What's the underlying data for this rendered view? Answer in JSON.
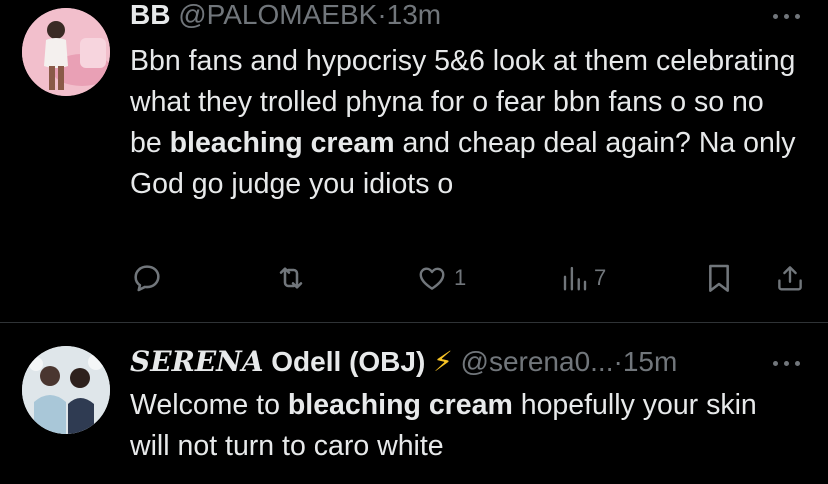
{
  "tweet1": {
    "name": "BB",
    "handle": "@PALOMAEBK",
    "separator": "·",
    "time": "13m",
    "body": {
      "part1": "Bbn fans and hypocrisy 5&6 look at them celebrating what they trolled phyna for o fear bbn fans o so no be ",
      "bold": "bleaching cream",
      "part2": " and cheap deal again? Na only God go judge you idiots o"
    },
    "actions": {
      "replies": "",
      "retweets": "",
      "likes": "1",
      "views": "7"
    }
  },
  "tweet2": {
    "name_stylized": "𝑺𝑬𝑹𝑬𝑵𝑨",
    "name_rest": " Odell (OBJ) ",
    "lightning": "⚡",
    "handle": "@serena0...",
    "separator": "·",
    "time": "15m",
    "body": {
      "part1": "Welcome to ",
      "bold": "bleaching cream",
      "part2": " hopefully your skin will not turn to caro white"
    }
  },
  "colors": {
    "background": "#000000",
    "text": "#e7e9ea",
    "muted": "#71767b",
    "divider": "#2f3336",
    "lightning": "#f7c325"
  },
  "icons": [
    "reply-icon",
    "retweet-icon",
    "like-icon",
    "views-icon",
    "bookmark-icon",
    "share-icon",
    "more-icon"
  ]
}
